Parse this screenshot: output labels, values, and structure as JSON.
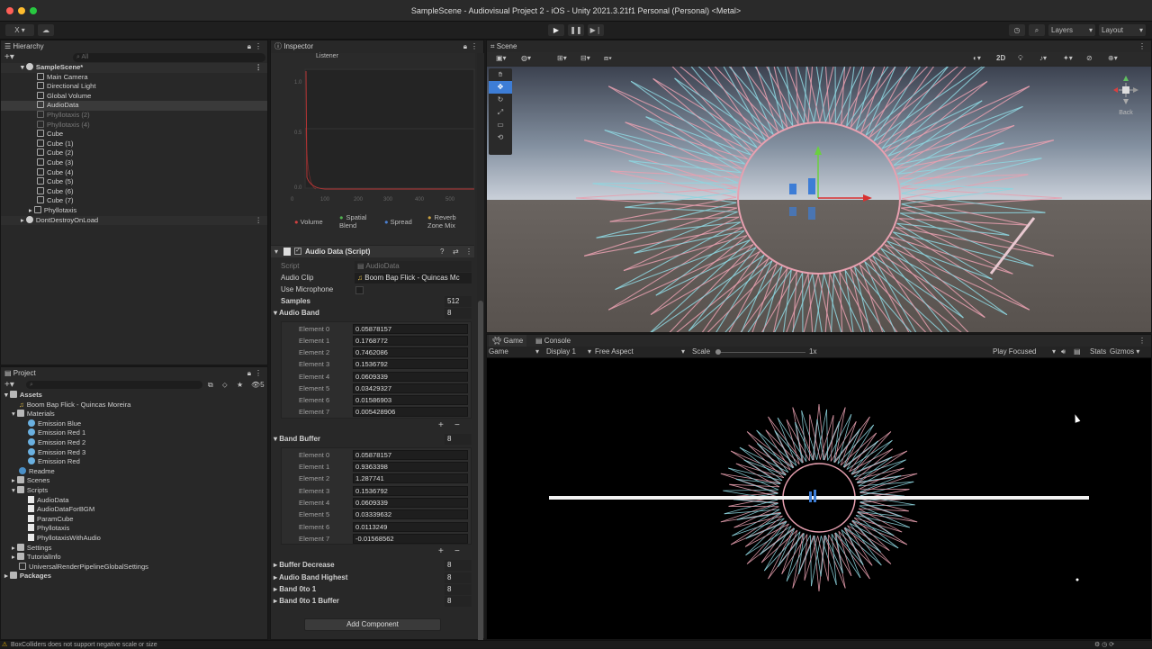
{
  "window": {
    "title": "SampleScene - Audiovisual Project 2 - iOS - Unity 2021.3.21f1 Personal (Personal) <Metal>"
  },
  "toolbar": {
    "account": "X",
    "layers": "Layers",
    "layout": "Layout"
  },
  "hierarchy": {
    "tab": "Hierarchy",
    "search_placeholder": "All",
    "scene": "SampleScene*",
    "items": [
      "Main Camera",
      "Directional Light",
      "Global Volume",
      "AudioData",
      "Phyllotaxis (2)",
      "Phyllotaxis (4)",
      "Cube",
      "Cube (1)",
      "Cube (2)",
      "Cube (3)",
      "Cube (4)",
      "Cube (5)",
      "Cube (6)",
      "Cube (7)",
      "Phyllotaxis"
    ],
    "dont_destroy": "DontDestroyOnLoad"
  },
  "project": {
    "tab": "Project",
    "count": "5",
    "assets": "Assets",
    "items": [
      "Boom Bap Flick - Quincas Moreira",
      "Materials",
      "Emission Blue",
      "Emission Red 1",
      "Emission Red 2",
      "Emission Red 3",
      "Emission Red",
      "Readme",
      "Scenes",
      "Scripts",
      "AudioData",
      "AudioDataForBGM",
      "ParamCube",
      "Phyllotaxis",
      "PhyllotaxisWithAudio",
      "Settings",
      "TutorialInfo",
      "UniversalRenderPipelineGlobalSettings"
    ],
    "packages": "Packages"
  },
  "inspector": {
    "tab": "Inspector",
    "graph_title": "Listener",
    "graph_y": [
      "1.0",
      "0.5",
      "0.0"
    ],
    "graph_x": [
      "0",
      "100",
      "200",
      "300",
      "400",
      "500"
    ],
    "legend": [
      "Volume",
      "Spatial Blend",
      "Spread",
      "Reverb Zone Mix"
    ],
    "component_title": "Audio Data (Script)",
    "script_label": "Script",
    "script_value": "AudioData",
    "audio_clip_label": "Audio Clip",
    "audio_clip_value": "Boom Bap Flick - Quincas Mc",
    "use_mic_label": "Use Microphone",
    "samples_label": "Samples",
    "samples_value": "512",
    "audio_band_label": "Audio Band",
    "audio_band_size": "8",
    "audio_band": [
      "0.05878157",
      "0.1768772",
      "0.7462086",
      "0.1536792",
      "0.0609339",
      "0.03429327",
      "0.01586903",
      "0.005428906"
    ],
    "band_buffer_label": "Band Buffer",
    "band_buffer_size": "8",
    "band_buffer": [
      "0.05878157",
      "0.9363398",
      "1.287741",
      "0.1536792",
      "0.0609339",
      "0.03339632",
      "0.0113249",
      "-0.01568562"
    ],
    "element_prefix": "Element",
    "element_names": [
      "Element 0",
      "Element 1",
      "Element 2",
      "Element 3",
      "Element 4",
      "Element 5",
      "Element 6",
      "Element 7"
    ],
    "fields": [
      {
        "label": "Buffer Decrease",
        "value": "8"
      },
      {
        "label": "Audio Band Highest",
        "value": "8"
      },
      {
        "label": "Band 0to 1",
        "value": "8"
      },
      {
        "label": "Band 0to 1 Buffer",
        "value": "8"
      }
    ],
    "add_component": "Add Component"
  },
  "scene": {
    "tab": "Scene",
    "mode_2d": "2D",
    "back_label": "Back"
  },
  "game": {
    "tab_game": "Game",
    "tab_console": "Console",
    "display_mode": "Game",
    "display": "Display 1",
    "aspect": "Free Aspect",
    "scale_label": "Scale",
    "scale_value": "1x",
    "play_focused": "Play Focused",
    "stats": "Stats",
    "gizmos": "Gizmos"
  },
  "status": {
    "message": "BoxColliders does not support negative scale or size"
  },
  "colors": {
    "accent": "#3d7dd6",
    "pink": "#e8a0b0",
    "cyan": "#8ed6e0",
    "warning": "#e6b000"
  }
}
